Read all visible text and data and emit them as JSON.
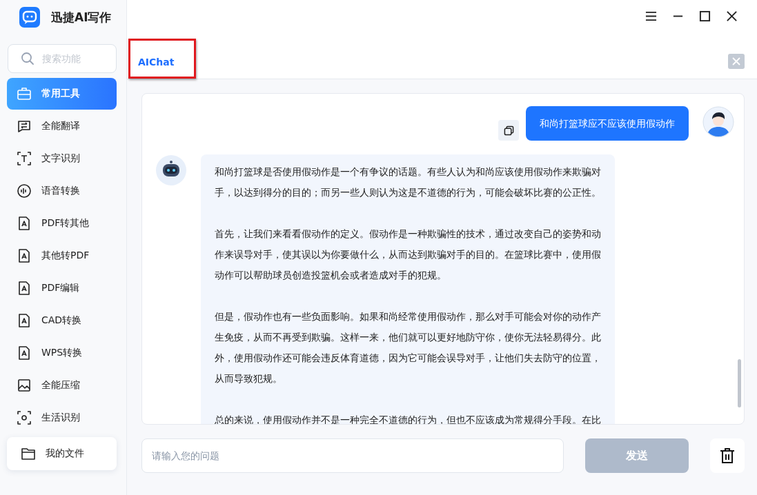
{
  "app": {
    "name": "迅捷AI写作"
  },
  "search": {
    "placeholder": "搜索功能"
  },
  "sidebar": {
    "items": [
      {
        "label": "常用工具",
        "selected": true
      },
      {
        "label": "全能翻译",
        "selected": false
      },
      {
        "label": "文字识别",
        "selected": false
      },
      {
        "label": "语音转换",
        "selected": false
      },
      {
        "label": "PDF转其他",
        "selected": false
      },
      {
        "label": "其他转PDF",
        "selected": false
      },
      {
        "label": "PDF编辑",
        "selected": false
      },
      {
        "label": "CAD转换",
        "selected": false
      },
      {
        "label": "WPS转换",
        "selected": false
      },
      {
        "label": "全能压缩",
        "selected": false
      },
      {
        "label": "生活识别",
        "selected": false
      }
    ]
  },
  "my_files": {
    "label": "我的文件"
  },
  "tabs": [
    {
      "label": "AIChat",
      "selected": true,
      "highlighted": true
    }
  ],
  "chat": {
    "messages": [
      {
        "kind": "user",
        "text": "和尚打篮球应不应该使用假动作"
      },
      {
        "kind": "assistant",
        "paragraphs": [
          "和尚打篮球是否使用假动作是一个有争议的话题。有些人认为和尚应该使用假动作来欺骗对手，以达到得分的目的；而另一些人则认为这是不道德的行为，可能会破坏比赛的公正性。",
          "首先，让我们来看看假动作的定义。假动作是一种欺骗性的技术，通过改变自己的姿势和动作来误导对手，使其误以为你要做什么，从而达到欺骗对手的目的。在篮球比赛中，使用假动作可以帮助球员创造投篮机会或者造成对手的犯规。",
          "但是，假动作也有一些负面影响。如果和尚经常使用假动作，那么对手可能会对你的动作产生免疫，从而不再受到欺骗。这样一来，他们就可以更好地防守你，使你无法轻易得分。此外，使用假动作还可能会违反体育道德，因为它可能会误导对手，让他们失去防守的位置，从而导致犯规。",
          "总的来说，使用假动作并不是一种完全不道德的行为，但也不应该成为常规得分手段。在比"
        ]
      }
    ]
  },
  "composer": {
    "placeholder": "请输入您的问题",
    "send_label": "发送",
    "send_disabled": true
  }
}
